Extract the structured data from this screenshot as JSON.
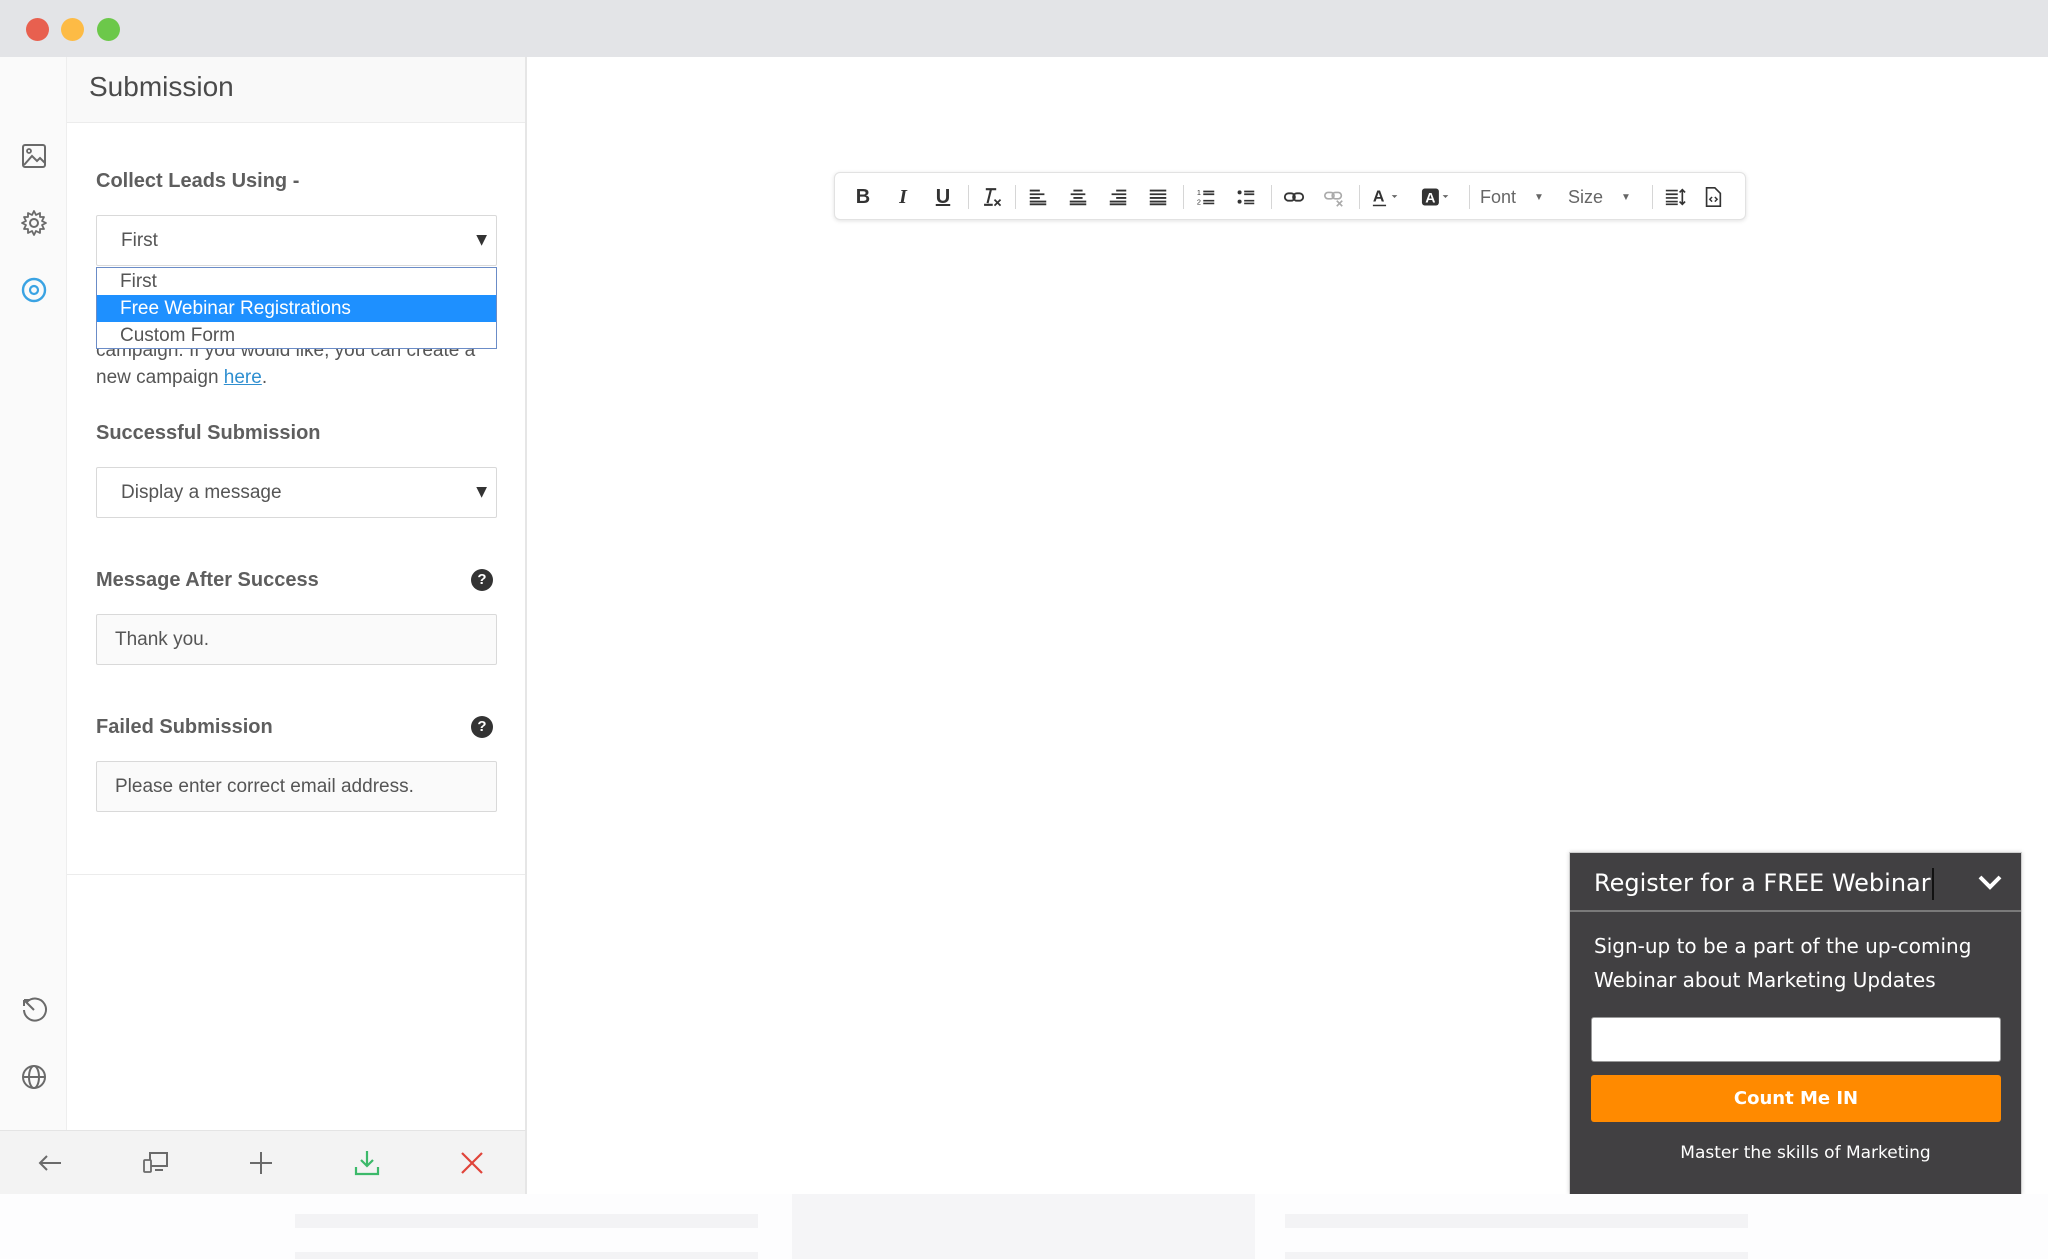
{
  "window": {
    "controls": [
      "close",
      "minimize",
      "maximize"
    ]
  },
  "rail": {
    "top_icons": [
      {
        "name": "image-icon",
        "active": false
      },
      {
        "name": "gear-icon",
        "active": false
      },
      {
        "name": "target-icon",
        "active": true
      }
    ],
    "bottom_icons": [
      {
        "name": "history-icon"
      },
      {
        "name": "globe-icon"
      }
    ],
    "active_color": "#3aa3e3"
  },
  "panel": {
    "title": "Submission",
    "collect_leads": {
      "label": "Collect Leads Using -",
      "selected": "First",
      "options": [
        "First",
        "Free Webinar Registrations",
        "Custom Form"
      ],
      "highlighted_option": "Free Webinar Registrations"
    },
    "help_text": {
      "visible_line": "campaign. If you would like, you can create a",
      "prefix": "new campaign ",
      "link": "here",
      "suffix": "."
    },
    "successful_submission": {
      "label": "Successful Submission",
      "selected": "Display a message"
    },
    "message_after_success": {
      "label": "Message After Success",
      "value": "Thank you.",
      "help": "?"
    },
    "failed_submission": {
      "label": "Failed Submission",
      "value": "Please enter correct email address.",
      "help": "?"
    }
  },
  "footer": {
    "buttons": [
      {
        "name": "back-button",
        "icon": "arrow-left-icon"
      },
      {
        "name": "responsive-preview-button",
        "icon": "devices-icon"
      },
      {
        "name": "add-button",
        "icon": "plus-icon"
      },
      {
        "name": "save-button",
        "icon": "download-icon",
        "color": "#3cb96a"
      },
      {
        "name": "close-button",
        "icon": "close-icon",
        "color": "#e0443a"
      }
    ]
  },
  "editor_toolbar": {
    "bold": "B",
    "italic": "I",
    "underline": "U",
    "clear_format": "T",
    "font_label": "Font",
    "size_label": "Size"
  },
  "widget": {
    "title": "Register for a FREE Webinar",
    "description": "Sign-up to be a part of the up-coming Webinar about Marketing Updates",
    "email_value": "",
    "button_label": "Count Me IN",
    "footer_text": "Master the skills of Marketing",
    "bg_color": "#414042",
    "button_color": "#ff8a00"
  }
}
